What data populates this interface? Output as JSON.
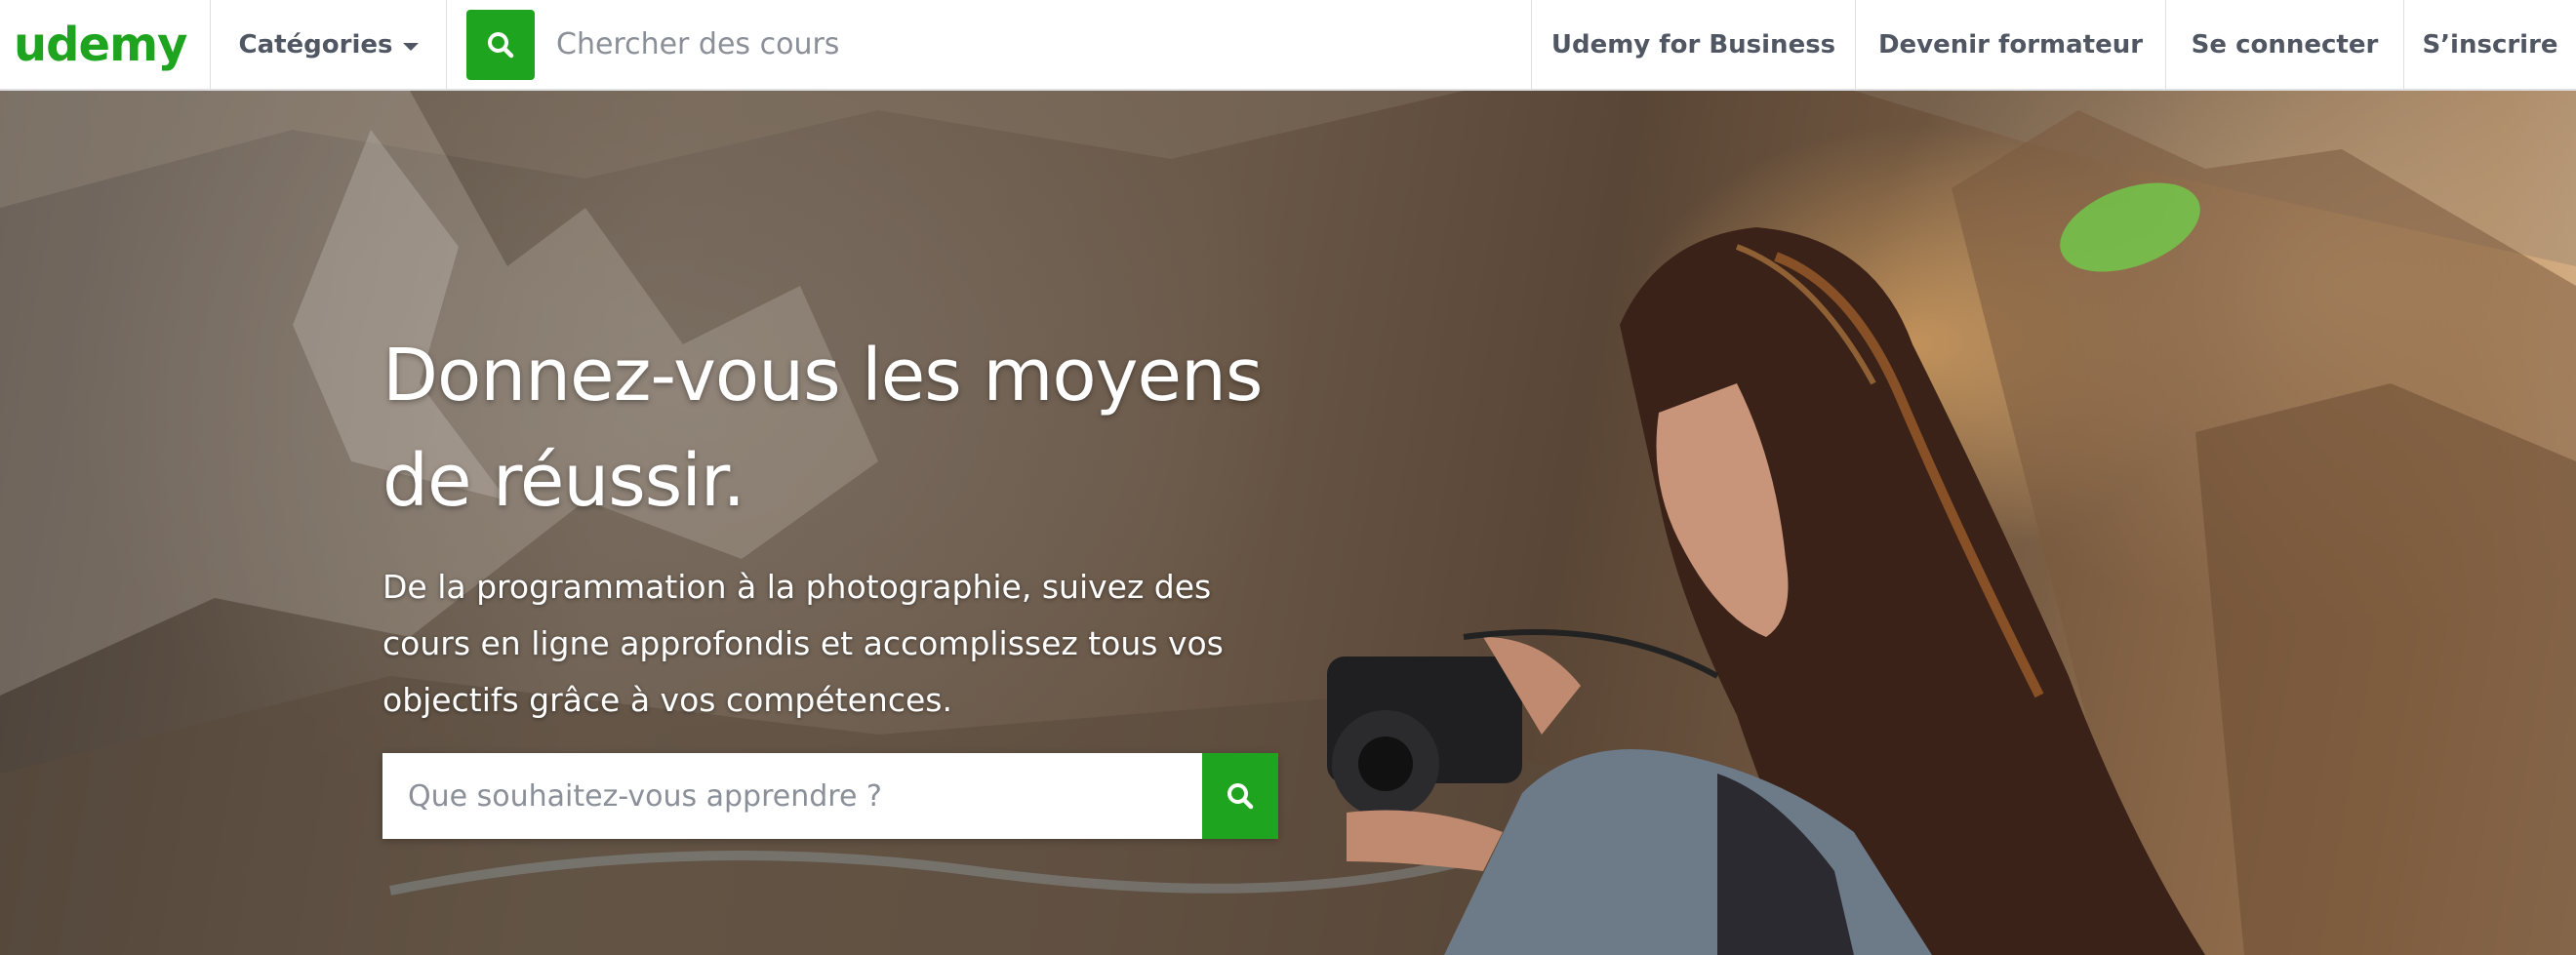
{
  "brand": {
    "logo_text": "udemy",
    "accent_color": "#1ea41e"
  },
  "header": {
    "categories_label": "Catégories",
    "categories_icon": "chevron-down-icon",
    "search": {
      "placeholder": "Chercher des cours",
      "icon": "search-icon"
    },
    "nav": {
      "business": "Udemy for Business",
      "teach": "Devenir formateur",
      "login": "Se connecter",
      "signup": "S’inscrire"
    }
  },
  "hero": {
    "title_line1": "Donnez-vous les moyens",
    "title_line2": "de réussir.",
    "subtitle_line1": "De la programmation à la photographie, suivez des",
    "subtitle_line2": "cours en ligne approfondis et accomplissez tous vos",
    "subtitle_line3": "objectifs grâce à vos compétences.",
    "search": {
      "placeholder": "Que souhaitez-vous apprendre ?",
      "icon": "search-icon"
    },
    "background_image": "woman-with-camera-on-mountain"
  }
}
